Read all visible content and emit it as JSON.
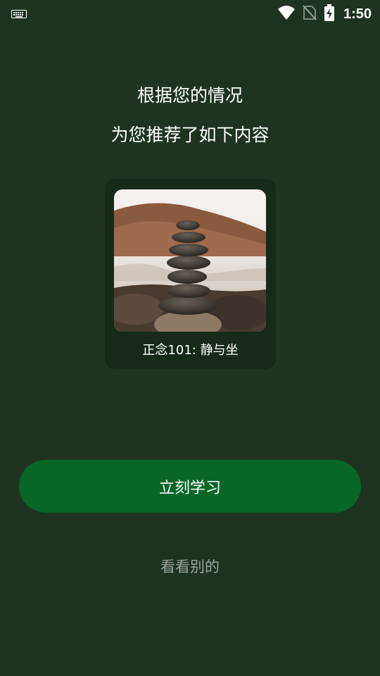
{
  "status_bar": {
    "time": "1:50",
    "icons": [
      "keyboard-icon",
      "wifi-icon",
      "no-sim-icon",
      "battery-charging-icon"
    ]
  },
  "headline": {
    "line1": "根据您的情况",
    "line2": "为您推荐了如下内容"
  },
  "recommendation": {
    "title": "正念101: 静与坐",
    "image": "stacked-stones-image"
  },
  "actions": {
    "primary_label": "立刻学习",
    "secondary_label": "看看别的"
  },
  "colors": {
    "background": "#1e3421",
    "card": "#172a1a",
    "primary_button": "#076628",
    "secondary_text": "#9aa39b"
  }
}
